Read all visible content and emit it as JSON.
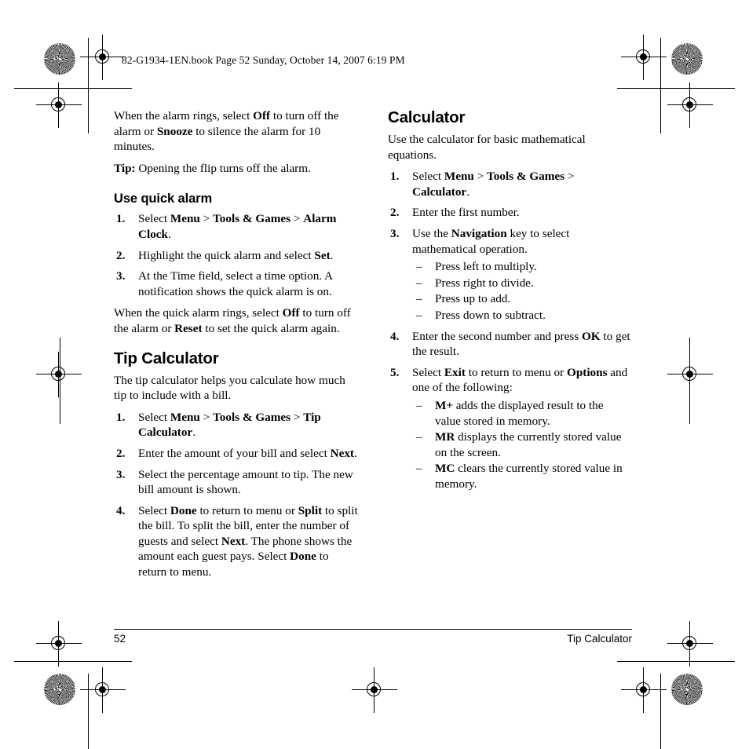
{
  "header": {
    "text": "82-G1934-1EN.book  Page 52  Sunday, October 14, 2007  6:19 PM"
  },
  "footer": {
    "page_number": "52",
    "section_name": "Tip Calculator"
  },
  "left_column": {
    "intro_paragraph": {
      "part1": "When the alarm rings, select ",
      "bold1": "Off",
      "part2": " to turn off the alarm or ",
      "bold2": "Snooze",
      "part3": " to silence the alarm for 10 minutes."
    },
    "tip_line": {
      "label": "Tip:",
      "text": " Opening the flip turns off the alarm."
    },
    "quick_alarm_heading": "Use quick alarm",
    "quick_alarm_steps": [
      {
        "num": "1.",
        "part1": "Select ",
        "bold1": "Menu",
        "part2": " > ",
        "bold2": "Tools & Games",
        "part3": " > ",
        "bold3": "Alarm Clock",
        "part4": "."
      },
      {
        "num": "2.",
        "part1": "Highlight the quick alarm and select ",
        "bold1": "Set",
        "part2": "."
      },
      {
        "num": "3.",
        "part1": "At the Time field, select a time option. A notification shows the quick alarm is on.",
        "bold1": "",
        "part2": ""
      }
    ],
    "quick_alarm_outro": {
      "part1": "When the quick alarm rings, select ",
      "bold1": "Off",
      "part2": " to turn off the alarm or ",
      "bold2": "Reset",
      "part3": " to set the quick alarm again."
    },
    "tip_calculator_heading": "Tip Calculator",
    "tip_calculator_intro": "The tip calculator helps you calculate how much tip to include with a bill.",
    "tip_calculator_steps": [
      {
        "num": "1.",
        "part1": "Select ",
        "bold1": "Menu",
        "part2": " > ",
        "bold2": "Tools & Games",
        "part3": " > ",
        "bold3": "Tip Calculator",
        "part4": "."
      },
      {
        "num": "2.",
        "part1": "Enter the amount of your bill and select ",
        "bold1": "Next",
        "part2": "."
      },
      {
        "num": "3.",
        "part1": "Select the percentage amount to tip. The new bill amount is shown.",
        "bold1": "",
        "part2": ""
      },
      {
        "num": "4.",
        "part1": "Select ",
        "bold1": "Done",
        "part2": " to return to menu or ",
        "bold2": "Split",
        "part3": " to split the bill. To split the bill, enter the number of guests and select ",
        "bold3": "Next",
        "part4": ". The phone shows the amount each guest pays. Select ",
        "bold4": "Done",
        "part5": " to return to menu."
      }
    ]
  },
  "right_column": {
    "calculator_heading": "Calculator",
    "calculator_intro": "Use the calculator for basic mathematical equations.",
    "calculator_steps": [
      {
        "num": "1.",
        "part1": "Select ",
        "bold1": "Menu",
        "part2": " > ",
        "bold2": "Tools & Games",
        "part3": " > ",
        "bold3": "Calculator",
        "part4": "."
      },
      {
        "num": "2.",
        "part1": "Enter the first number.",
        "bold1": "",
        "part2": ""
      },
      {
        "num": "3.",
        "part1": "Use the ",
        "bold1": "Navigation",
        "part2": " key to select mathematical operation."
      },
      {
        "num": "4.",
        "part1": "Enter the second number and press ",
        "bold1": "OK",
        "part2": " to get the result."
      },
      {
        "num": "5.",
        "part1": "Select ",
        "bold1": "Exit",
        "part2": " to return to menu or ",
        "bold2": "Options",
        "part3": " and one of the following:"
      }
    ],
    "navigation_sub_items": [
      {
        "dash": "–",
        "text": "Press left to multiply."
      },
      {
        "dash": "–",
        "text": "Press right to divide."
      },
      {
        "dash": "–",
        "text": "Press up to add."
      },
      {
        "dash": "–",
        "text": "Press down to subtract."
      }
    ],
    "memory_sub_items": [
      {
        "dash": "–",
        "bold": "M+",
        "text": " adds the displayed result to the value stored in memory."
      },
      {
        "dash": "–",
        "bold": "MR",
        "text": " displays the currently stored value on the screen."
      },
      {
        "dash": "–",
        "bold": "MC",
        "text": " clears the currently stored value in memory."
      }
    ]
  }
}
